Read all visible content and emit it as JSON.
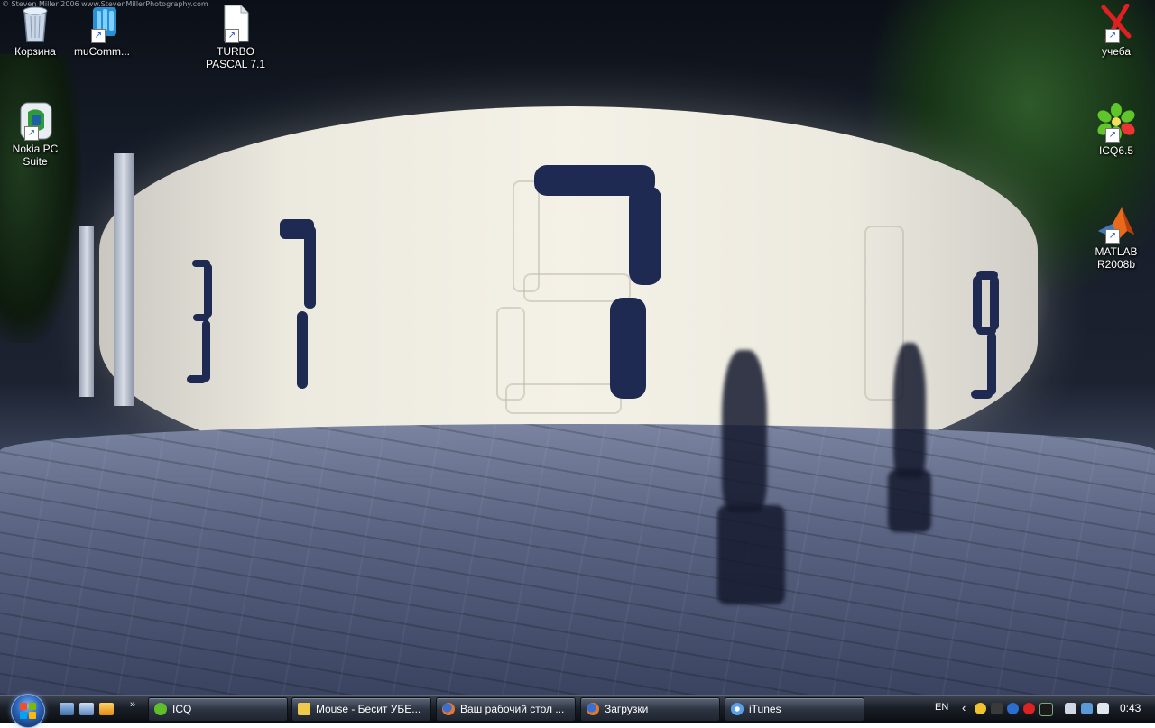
{
  "wallpaper": {
    "watermark": "© Steven Miller 2006 www.StevenMillerPhotography.com"
  },
  "desktop_icons": [
    {
      "name": "recycle-bin-icon",
      "label": "Корзина",
      "shortcut": false
    },
    {
      "name": "mucommander-icon",
      "label": "muComm...",
      "shortcut": true
    },
    {
      "name": "turbo-pascal-icon",
      "label": "TURBO PASCAL 7.1",
      "shortcut": true
    },
    {
      "name": "nokia-pc-suite-icon",
      "label": "Nokia PC Suite",
      "shortcut": true
    },
    {
      "name": "ucheba-icon",
      "label": "учеба",
      "shortcut": true
    },
    {
      "name": "icq-desktop-icon",
      "label": "ICQ6.5",
      "shortcut": true
    },
    {
      "name": "matlab-icon",
      "label": "MATLAB R2008b",
      "shortcut": true
    }
  ],
  "taskbar": {
    "quick_launch_more": "»",
    "buttons": [
      {
        "label": "ICQ",
        "icon": "icq-flower-icon",
        "color": "#5fbf2a"
      },
      {
        "label": "Mouse - Бесит УБЕ...",
        "icon": "folder-icon",
        "color": "#f0c84a"
      },
      {
        "label": "Ваш рабочий стол ...",
        "icon": "firefox-icon",
        "color": "#e8772a"
      },
      {
        "label": "Загрузки",
        "icon": "firefox-icon",
        "color": "#e8772a"
      },
      {
        "label": "iTunes",
        "icon": "itunes-icon",
        "color": "#5aa0e8"
      }
    ],
    "language": "EN",
    "tray_chevron": "‹",
    "clock": "0:43"
  }
}
